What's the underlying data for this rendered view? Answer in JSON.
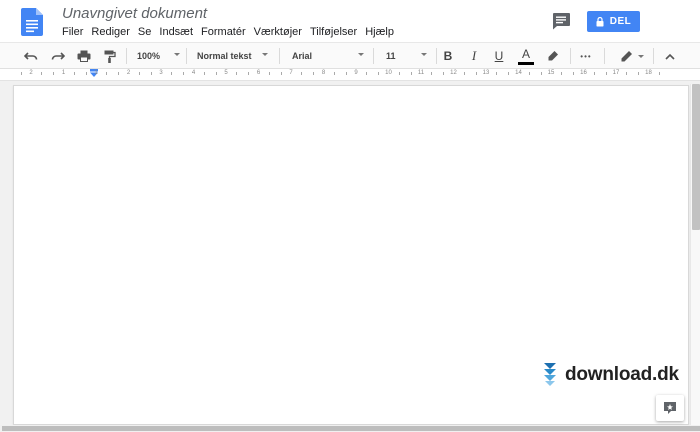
{
  "document": {
    "title": "Unavngivet dokument"
  },
  "menu": [
    "Filer",
    "Rediger",
    "Se",
    "Indsæt",
    "Formatér",
    "Værktøjer",
    "Tilføjelser",
    "Hjælp"
  ],
  "share": {
    "label": "DEL"
  },
  "toolbar": {
    "zoom": "100%",
    "style": "Normal tekst",
    "font": "Arial",
    "size": "11",
    "bold": "B",
    "italic": "I",
    "underline": "U",
    "text_color_letter": "A",
    "more": "•••"
  },
  "ruler": {
    "labels": [
      "2",
      "1",
      "1",
      "2",
      "3",
      "4",
      "5",
      "6",
      "7",
      "8",
      "9",
      "10",
      "11",
      "12",
      "13",
      "14",
      "15",
      "16",
      "17",
      "18"
    ]
  },
  "watermark": {
    "text": "download.dk"
  },
  "colors": {
    "accent": "#4285f4",
    "docs_blue": "#4285f4",
    "watermark_blue": "#2a8ac9"
  }
}
